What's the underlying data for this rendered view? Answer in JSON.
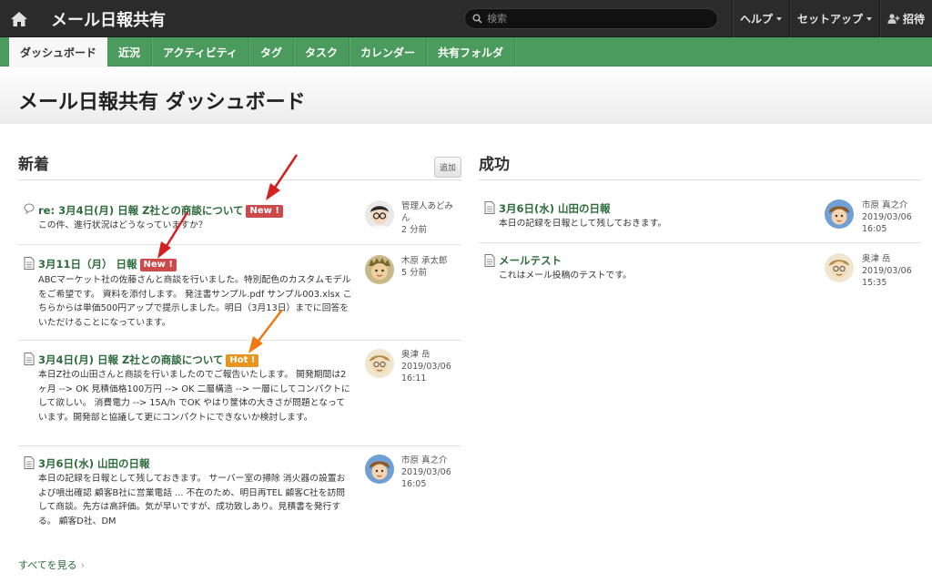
{
  "app": {
    "title": "メール日報共有"
  },
  "search": {
    "placeholder": "検索"
  },
  "topnav": {
    "help": "ヘルプ",
    "setup": "セットアップ",
    "invite": "招待"
  },
  "tabs": [
    "ダッシュボード",
    "近況",
    "アクティビティ",
    "タグ",
    "タスク",
    "カレンダー",
    "共有フォルダ"
  ],
  "active_tab": "ダッシュボード",
  "page": {
    "title": "メール日報共有 ダッシュボード"
  },
  "left": {
    "title": "新着",
    "add_label": "追加",
    "items": [
      {
        "type": "comment",
        "title": "re: 3月4日(月) 日報 Z社との商談について",
        "badge": "New !",
        "badge_type": "new",
        "body": "この件、進行状況はどうなっていますか？",
        "author": "管理人あどみん",
        "time": "2 分前"
      },
      {
        "type": "doc",
        "title": "3月11日（月） 日報",
        "badge": "New !",
        "badge_type": "new",
        "body": "ABCマーケット社の佐藤さんと商談を行いました。特別配色のカスタムモデルをご希望です。 資料を添付します。 発注書サンプル.pdf サンプル003.xlsx こちらからは単価500円アップで提示しました。明日（3月13日）までに回答をいただけることになっています。",
        "author": "木原 承太郎",
        "time": "5 分前"
      },
      {
        "type": "doc",
        "title": "3月4日(月) 日報 Z社との商談について",
        "badge": "Hot !",
        "badge_type": "hot",
        "body": "本日Z社の山田さんと商談を行いましたのでご報告いたします。 開発期間は2ヶ月 --> OK 見積価格100万円 --> OK 二層構造 --> 一層にしてコンパクトにして欲しい。 消費電力 --> 15A/h でOK やはり筐体の大きさが問題となっています。開発部と協議して更にコンパクトにできないか検討します。",
        "author": "奥津 岳",
        "time": "2019/03/06 16:11"
      },
      {
        "type": "doc",
        "title": "3月6日(水) 山田の日報",
        "badge": "",
        "badge_type": "",
        "body": "本日の記録を日報として残しておきます。 サーバー室の掃除 消火器の設置および噴出確認 顧客B社に営業電話 ... 不在のため、明日再TEL 顧客C社を訪問して商談。先方は高評価。気が早いですが、成功致しあり。見積書を発行する。 顧客D社、DM",
        "author": "市原 真之介",
        "time": "2019/03/06 16:05"
      }
    ],
    "more": "すべてを見る"
  },
  "right": {
    "title": "成功",
    "items": [
      {
        "type": "doc",
        "title": "3月6日(水) 山田の日報",
        "body": "本日の記録を日報として残しておきます。",
        "author": "市原 真之介",
        "time": "2019/03/06 16:05"
      },
      {
        "type": "doc",
        "title": "メールテスト",
        "body": "これはメール投稿のテストです。",
        "author": "奥津 岳",
        "time": "2019/03/06 15:35"
      }
    ]
  },
  "colors": {
    "topbar": "#2b2b2b",
    "tabbar": "#4a9b5d",
    "link": "#2d6b3c",
    "badge_new": "#cc4a4a",
    "badge_hot": "#e8941e",
    "arrow_red": "#d42020",
    "arrow_orange": "#ef7a12"
  }
}
